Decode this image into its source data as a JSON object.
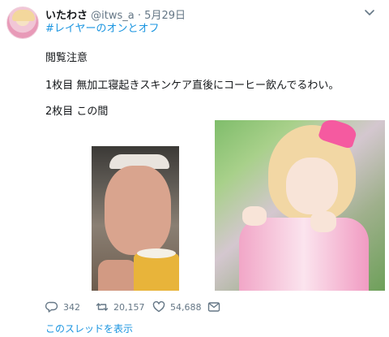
{
  "tweet": {
    "display_name": "いたわさ",
    "handle": "@itws_a",
    "separator": "·",
    "date": "5月29日",
    "hashtag": "#レイヤーのオンとオフ",
    "lines": [
      "閲覧注意",
      "1枚目 無加工寝起きスキンケア直後にコーヒー飲んでるわい。",
      "2枚目 この間"
    ],
    "images": [
      "photo-1",
      "photo-2"
    ]
  },
  "actions": {
    "reply_count": "342",
    "retweet_count": "20,157",
    "like_count": "54,688",
    "icons": [
      "reply-icon",
      "retweet-icon",
      "like-icon",
      "dm-icon"
    ]
  },
  "thread_link": "このスレッドを表示",
  "colors": {
    "link": "#1b95e0",
    "text": "#14171a",
    "muted": "#657786"
  }
}
